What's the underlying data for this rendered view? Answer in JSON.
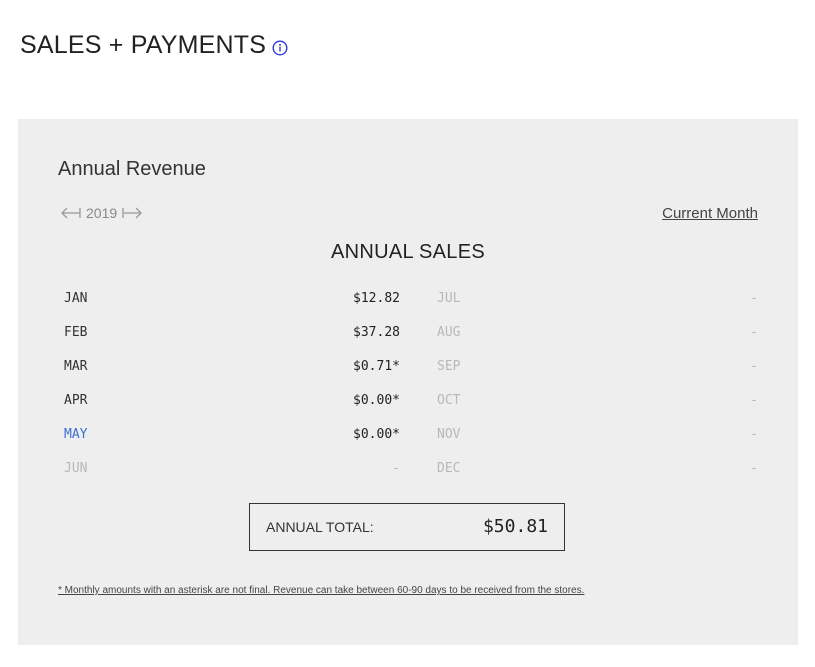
{
  "header": {
    "title": "SALES + PAYMENTS",
    "info_icon": "info-circle-icon",
    "accent_color": "#2b3bd6"
  },
  "panel": {
    "section_title": "Annual Revenue",
    "year_nav": {
      "prev_icon": "arrow-left-bar-icon",
      "year": "2019",
      "next_icon": "arrow-right-bar-icon"
    },
    "current_month_link": "Current Month",
    "sales_heading": "ANNUAL SALES",
    "months_left": [
      {
        "month": "JAN",
        "value": "$12.82",
        "state": "past"
      },
      {
        "month": "FEB",
        "value": "$37.28",
        "state": "past"
      },
      {
        "month": "MAR",
        "value": "$0.71*",
        "state": "past"
      },
      {
        "month": "APR",
        "value": "$0.00*",
        "state": "past"
      },
      {
        "month": "MAY",
        "value": "$0.00*",
        "state": "current"
      },
      {
        "month": "JUN",
        "value": "-",
        "state": "future"
      }
    ],
    "months_right": [
      {
        "month": "JUL",
        "value": "-",
        "state": "future"
      },
      {
        "month": "AUG",
        "value": "-",
        "state": "future"
      },
      {
        "month": "SEP",
        "value": "-",
        "state": "future"
      },
      {
        "month": "OCT",
        "value": "-",
        "state": "future"
      },
      {
        "month": "NOV",
        "value": "-",
        "state": "future"
      },
      {
        "month": "DEC",
        "value": "-",
        "state": "future"
      }
    ],
    "annual_total_label": "ANNUAL TOTAL:",
    "annual_total_value": "$50.81",
    "footnote": "* Monthly amounts with an asterisk are not final. Revenue can take between 60-90 days to be received from the stores.",
    "colors": {
      "panel_bg": "#eeeeee",
      "current_month": "#3b6fd4",
      "future_month": "#b8b8b8"
    }
  }
}
